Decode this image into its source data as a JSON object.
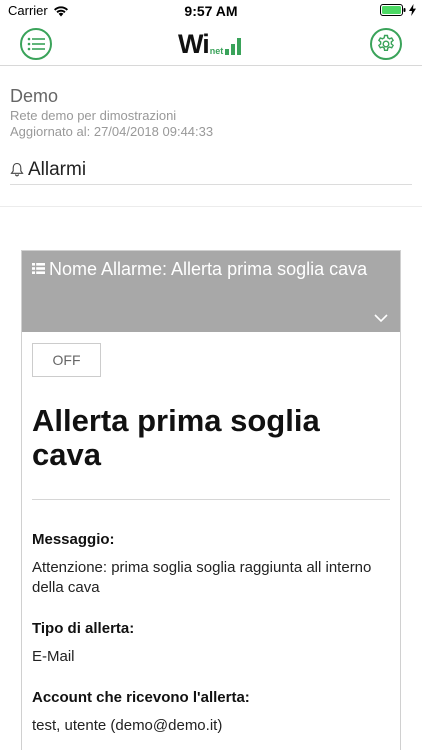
{
  "status_bar": {
    "carrier": "Carrier",
    "time": "9:57 AM",
    "icons": [
      "wifi-icon",
      "battery-icon",
      "charging-icon"
    ]
  },
  "navbar": {
    "logo_text": "Wi",
    "logo_sub": "net",
    "menu_icon": "list-icon",
    "settings_icon": "gear-icon",
    "accent_color": "#3aa35a"
  },
  "network": {
    "name": "Demo",
    "description": "Rete demo per dimostrazioni",
    "updated": "Aggiornato al: 27/04/2018 09:44:33"
  },
  "section": {
    "icon": "bell-icon",
    "title": "Allarmi"
  },
  "alarm_card": {
    "header_icon": "list-icon",
    "header_title": "Nome Allarme: Allerta prima soglia cava",
    "header_bg": "#a8a8a8",
    "toggle_label": "OFF",
    "title": "Allerta prima soglia cava",
    "fields": [
      {
        "label": "Messaggio:",
        "value": "Attenzione: prima soglia soglia raggiunta all interno della cava"
      },
      {
        "label": "Tipo di allerta:",
        "value": "E-Mail"
      },
      {
        "label": "Account che ricevono l'allerta:",
        "value": "test, utente (demo@demo.it)"
      }
    ]
  }
}
